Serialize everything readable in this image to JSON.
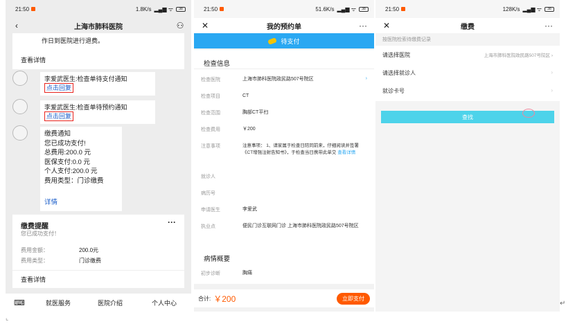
{
  "panel1": {
    "status": {
      "time": "21:50",
      "speed": "1.8K/s",
      "battery": "38"
    },
    "title": "上海市肺科医院",
    "top_text": "作日到医院进行退费。",
    "view_detail": "查看详情",
    "msgs": [
      {
        "text": "李爱武医生:检查单待支付通知",
        "link": "点击回复"
      },
      {
        "text": "李爱武医生:检查单待预约通知",
        "link": "点击回复"
      }
    ],
    "payment_notice": {
      "lines": [
        "缴费通知",
        "您已成功支付!",
        "总费用:200.0 元",
        "医保支付:0.0 元",
        "个人支付:200.0 元",
        "费用类型：门诊缴费"
      ],
      "detail": "详情"
    },
    "reminder": {
      "title": "缴费提醒",
      "sub": "您已成功支付！",
      "rows": [
        {
          "k": "费用金额：",
          "v": "200.0元"
        },
        {
          "k": "费用类型：",
          "v": "门诊缴费"
        }
      ],
      "more": "···",
      "view": "查看详情"
    },
    "tabs": [
      "就医服务",
      "医院介绍",
      "个人中心"
    ]
  },
  "panel2": {
    "status": {
      "time": "21:50",
      "speed": "51.6K/s",
      "battery": "38"
    },
    "title": "我的预约单",
    "banner": "待支付",
    "section": "检查信息",
    "rows": [
      {
        "k": "检查医院",
        "v": "上海市肺科医院政民路507号院区"
      },
      {
        "k": "检查项目",
        "v": "CT"
      },
      {
        "k": "检查范围",
        "v": "胸部CT平扫"
      },
      {
        "k": "检查费用",
        "v": "￥200"
      },
      {
        "k": "注意事项",
        "v": "注意事项： 1、请家属于检查日陪同前来，仔细阅读并签署《CT增强注射告知书》，于检查当日携带此单交",
        "link": "查看详情"
      },
      {
        "k": "就诊人",
        "v": ""
      },
      {
        "k": "病历号",
        "v": ""
      },
      {
        "k": "申请医生",
        "v": "李爱武"
      },
      {
        "k": "执业点",
        "v": "便民门诊互联网门诊 上海市肺科医院政民路507号院区"
      }
    ],
    "section2": "病情概要",
    "diag": {
      "k": "初步诊断",
      "v": "胸痛"
    },
    "total_label": "合计:",
    "total": "￥200",
    "pay_button": "立即支付"
  },
  "panel3": {
    "status": {
      "time": "21:50",
      "speed": "128K/s",
      "battery": "38"
    },
    "title": "缴费",
    "hint": "按医院检索待缴费记录",
    "rows": [
      {
        "k": "请选择医院",
        "v": "上海市肺科医院政民路507号院区"
      },
      {
        "k": "请选择就诊人",
        "v": ""
      },
      {
        "k": "就诊卡号",
        "v": ""
      }
    ],
    "search_button": "查找"
  },
  "colors": {
    "accent": "#2aa8f2",
    "red": "#e8221c",
    "cyan": "#4dd3ea",
    "orange": "#ff5a00"
  }
}
